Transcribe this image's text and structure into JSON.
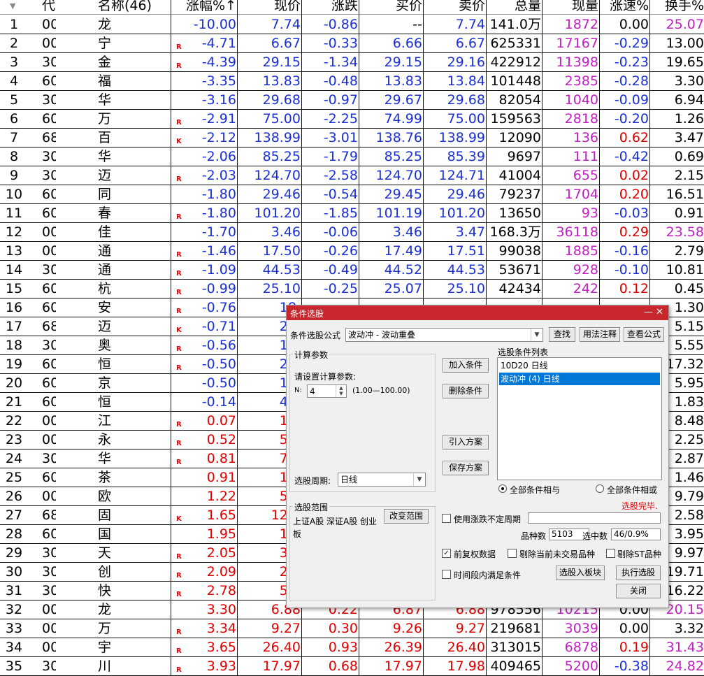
{
  "columns": [
    "代",
    "名称(46)",
    "涨幅%↑",
    "现价",
    "涨跌",
    "买价",
    "卖价",
    "总量",
    "现量",
    "涨速%",
    "换手%"
  ],
  "rows": [
    {
      "n": "1",
      "code": "00",
      "name": "龙",
      "r": "",
      "chg": "-10.00",
      "price": "7.74",
      "diff": "-0.86",
      "bid": "--",
      "ask": "7.74",
      "vol": "141.0万",
      "cur": "1872",
      "spd": "0.00",
      "turn": "25.07"
    },
    {
      "n": "2",
      "code": "00",
      "name": "宁",
      "r": "R",
      "chg": "-4.71",
      "price": "6.67",
      "diff": "-0.33",
      "bid": "6.66",
      "ask": "6.67",
      "vol": "625331",
      "cur": "17167",
      "spd": "-0.29",
      "turn": "13.00"
    },
    {
      "n": "3",
      "code": "30",
      "name": "金",
      "r": "R",
      "chg": "-4.39",
      "price": "29.15",
      "diff": "-1.34",
      "bid": "29.15",
      "ask": "29.16",
      "vol": "422912",
      "cur": "11398",
      "spd": "-0.23",
      "turn": "19.65"
    },
    {
      "n": "4",
      "code": "60",
      "name": "福",
      "r": "",
      "chg": "-3.35",
      "price": "13.83",
      "diff": "-0.48",
      "bid": "13.83",
      "ask": "13.84",
      "vol": "101448",
      "cur": "2385",
      "spd": "-0.28",
      "turn": "3.30"
    },
    {
      "n": "5",
      "code": "30",
      "name": "华",
      "r": "",
      "chg": "-3.16",
      "price": "29.68",
      "diff": "-0.97",
      "bid": "29.67",
      "ask": "29.68",
      "vol": "82054",
      "cur": "1040",
      "spd": "-0.09",
      "turn": "6.94"
    },
    {
      "n": "6",
      "code": "60",
      "name": "万",
      "r": "R",
      "chg": "-2.91",
      "price": "75.00",
      "diff": "-2.25",
      "bid": "74.99",
      "ask": "75.00",
      "vol": "159563",
      "cur": "2818",
      "spd": "-0.20",
      "turn": "1.26"
    },
    {
      "n": "7",
      "code": "68",
      "name": "百",
      "r": "K",
      "chg": "-2.12",
      "price": "138.99",
      "diff": "-3.01",
      "bid": "138.76",
      "ask": "138.99",
      "vol": "12090",
      "cur": "136",
      "spd": "0.62",
      "turn": "3.47"
    },
    {
      "n": "8",
      "code": "30",
      "name": "华",
      "r": "",
      "chg": "-2.06",
      "price": "85.25",
      "diff": "-1.79",
      "bid": "85.25",
      "ask": "85.39",
      "vol": "9697",
      "cur": "111",
      "spd": "-0.42",
      "turn": "0.69"
    },
    {
      "n": "9",
      "code": "30",
      "name": "迈",
      "r": "R",
      "chg": "-2.03",
      "price": "124.70",
      "diff": "-2.58",
      "bid": "124.70",
      "ask": "124.71",
      "vol": "41004",
      "cur": "655",
      "spd": "0.02",
      "turn": "2.15"
    },
    {
      "n": "10",
      "code": "60",
      "name": "同",
      "r": "",
      "chg": "-1.80",
      "price": "29.46",
      "diff": "-0.54",
      "bid": "29.45",
      "ask": "29.46",
      "vol": "79237",
      "cur": "1704",
      "spd": "0.20",
      "turn": "16.51"
    },
    {
      "n": "11",
      "code": "60",
      "name": "春",
      "r": "R",
      "chg": "-1.80",
      "price": "101.20",
      "diff": "-1.85",
      "bid": "101.19",
      "ask": "101.20",
      "vol": "13650",
      "cur": "93",
      "spd": "-0.03",
      "turn": "0.91"
    },
    {
      "n": "12",
      "code": "00",
      "name": "佳",
      "r": "",
      "chg": "-1.70",
      "price": "3.46",
      "diff": "-0.06",
      "bid": "3.46",
      "ask": "3.47",
      "vol": "168.3万",
      "cur": "36118",
      "spd": "0.29",
      "turn": "23.58"
    },
    {
      "n": "13",
      "code": "00",
      "name": "通",
      "r": "R",
      "chg": "-1.46",
      "price": "17.50",
      "diff": "-0.26",
      "bid": "17.49",
      "ask": "17.51",
      "vol": "99038",
      "cur": "1885",
      "spd": "-0.16",
      "turn": "2.79"
    },
    {
      "n": "14",
      "code": "30",
      "name": "通",
      "r": "R",
      "chg": "-1.09",
      "price": "44.53",
      "diff": "-0.49",
      "bid": "44.52",
      "ask": "44.53",
      "vol": "53671",
      "cur": "928",
      "spd": "-0.10",
      "turn": "10.81"
    },
    {
      "n": "15",
      "code": "60",
      "name": "杭",
      "r": "R",
      "chg": "-0.99",
      "price": "25.10",
      "diff": "-0.25",
      "bid": "25.07",
      "ask": "25.10",
      "vol": "42434",
      "cur": "242",
      "spd": "0.12",
      "turn": "0.45"
    },
    {
      "n": "16",
      "code": "60",
      "name": "安",
      "r": "R",
      "chg": "-0.76",
      "price": "18.",
      "diff": "",
      "bid": "",
      "ask": "",
      "vol": "",
      "cur": "",
      "spd": "",
      "turn": "1.30"
    },
    {
      "n": "17",
      "code": "68",
      "name": "迈",
      "r": "K",
      "chg": "-0.71",
      "price": "27.",
      "diff": "",
      "bid": "",
      "ask": "",
      "vol": "",
      "cur": "",
      "spd": "",
      "turn": "5.15"
    },
    {
      "n": "18",
      "code": "30",
      "name": "奥",
      "r": "R",
      "chg": "-0.56",
      "price": "10.",
      "diff": "",
      "bid": "",
      "ask": "",
      "vol": "",
      "cur": "",
      "spd": "",
      "turn": "5.55"
    },
    {
      "n": "19",
      "code": "60",
      "name": "恒",
      "r": "R",
      "chg": "-0.50",
      "price": "25.",
      "diff": "",
      "bid": "",
      "ask": "",
      "vol": "",
      "cur": "",
      "spd": "",
      "turn": "17.32"
    },
    {
      "n": "20",
      "code": "60",
      "name": "京",
      "r": "",
      "chg": "-0.50",
      "price": "17.",
      "diff": "",
      "bid": "",
      "ask": "",
      "vol": "",
      "cur": "",
      "spd": "",
      "turn": "5.95"
    },
    {
      "n": "21",
      "code": "60",
      "name": "恒",
      "r": "",
      "chg": "-0.14",
      "price": "43.",
      "diff": "",
      "bid": "",
      "ask": "",
      "vol": "",
      "cur": "",
      "spd": "",
      "turn": "1.83"
    },
    {
      "n": "22",
      "code": "00",
      "name": "江",
      "r": "R",
      "chg": "0.07",
      "price": "13.",
      "diff": "",
      "bid": "",
      "ask": "",
      "vol": "",
      "cur": "",
      "spd": "",
      "turn": "8.48"
    },
    {
      "n": "23",
      "code": "00",
      "name": "永",
      "r": "R",
      "chg": "0.52",
      "price": "51.",
      "diff": "",
      "bid": "",
      "ask": "",
      "vol": "",
      "cur": "",
      "spd": "",
      "turn": "2.25"
    },
    {
      "n": "24",
      "code": "30",
      "name": "华",
      "r": "R",
      "chg": "0.81",
      "price": "74.",
      "diff": "",
      "bid": "",
      "ask": "",
      "vol": "",
      "cur": "",
      "spd": "",
      "turn": "2.87"
    },
    {
      "n": "25",
      "code": "60",
      "name": "茶",
      "r": "",
      "chg": "0.91",
      "price": "17.",
      "diff": "",
      "bid": "",
      "ask": "",
      "vol": "",
      "cur": "",
      "spd": "",
      "turn": "1.46"
    },
    {
      "n": "26",
      "code": "00",
      "name": "欧",
      "r": "",
      "chg": "1.22",
      "price": "51.",
      "diff": "",
      "bid": "",
      "ask": "",
      "vol": "",
      "cur": "",
      "spd": "",
      "turn": "9.79"
    },
    {
      "n": "27",
      "code": "68",
      "name": "固",
      "r": "K",
      "chg": "1.65",
      "price": "128.",
      "diff": "",
      "bid": "",
      "ask": "",
      "vol": "",
      "cur": "",
      "spd": "",
      "turn": "2.58"
    },
    {
      "n": "28",
      "code": "60",
      "name": "国",
      "r": "",
      "chg": "1.95",
      "price": "10.",
      "diff": "",
      "bid": "",
      "ask": "",
      "vol": "",
      "cur": "",
      "spd": "",
      "turn": "3.95"
    },
    {
      "n": "29",
      "code": "30",
      "name": "天",
      "r": "R",
      "chg": "2.05",
      "price": "37.",
      "diff": "",
      "bid": "",
      "ask": "",
      "vol": "",
      "cur": "",
      "spd": "",
      "turn": "9.97"
    },
    {
      "n": "30",
      "code": "30",
      "name": "创",
      "r": "R",
      "chg": "2.09",
      "price": "25.",
      "diff": "",
      "bid": "",
      "ask": "",
      "vol": "",
      "cur": "",
      "spd": "",
      "turn": "19.71"
    },
    {
      "n": "31",
      "code": "30",
      "name": "快",
      "r": "R",
      "chg": "2.78",
      "price": "58.",
      "diff": "",
      "bid": "",
      "ask": "",
      "vol": "",
      "cur": "",
      "spd": "",
      "turn": "16.22"
    },
    {
      "n": "32",
      "code": "00",
      "name": "龙",
      "r": "",
      "chg": "3.30",
      "price": "6.88",
      "diff": "0.22",
      "bid": "6.87",
      "ask": "6.88",
      "vol": "978556",
      "cur": "10215",
      "spd": "0.00",
      "turn": "20.15"
    },
    {
      "n": "33",
      "code": "00",
      "name": "万",
      "r": "R",
      "chg": "3.34",
      "price": "9.27",
      "diff": "0.30",
      "bid": "9.26",
      "ask": "9.27",
      "vol": "219681",
      "cur": "3039",
      "spd": "0.00",
      "turn": "3.32"
    },
    {
      "n": "34",
      "code": "00",
      "name": "宇",
      "r": "R",
      "chg": "3.65",
      "price": "26.40",
      "diff": "0.93",
      "bid": "26.39",
      "ask": "26.40",
      "vol": "313015",
      "cur": "6878",
      "spd": "0.19",
      "turn": "31.43"
    },
    {
      "n": "35",
      "code": "30",
      "name": "川",
      "r": "R",
      "chg": "3.93",
      "price": "17.97",
      "diff": "0.68",
      "bid": "17.97",
      "ask": "17.98",
      "vol": "409465",
      "cur": "5200",
      "spd": "-0.38",
      "turn": "24.82"
    }
  ],
  "colors": {
    "up": "#e00000",
    "down": "#1a2fd6",
    "vol": "#c020c0",
    "text": "#000000"
  },
  "dialog": {
    "title": "条件选股",
    "minimize": "—",
    "close": "✕",
    "formula_label": "条件选股公式",
    "formula_value": "波动冲 - 波动重叠",
    "find_btn": "查找",
    "usage_btn": "用法注释",
    "view_btn": "查看公式",
    "calc_group": "计算参数",
    "param_prompt": "请设置计算参数:",
    "param_name": "N:",
    "param_value": "4",
    "param_range": "(1.00—100.00)",
    "period_label": "选股周期:",
    "period_value": "日线",
    "add_btn": "加入条件",
    "del_btn": "删除条件",
    "import_btn": "引入方案",
    "save_btn": "保存方案",
    "list_label": "选股条件列表",
    "list_items": [
      "10D20  日线",
      "波动冲 (4) 日线"
    ],
    "radio_and": "全部条件相与",
    "radio_or": "全部条件相或",
    "status": "选股完毕.",
    "scope_group": "选股范围",
    "scope_text": "上证A股 深证A股 创业板",
    "scope_btn": "改变范围",
    "chk_unfixed": "使用涨跌不定周期",
    "count_label": "品种数",
    "count_value": "5103",
    "selected_label": "选中数",
    "selected_value": "46/0.9%",
    "chk_adjust": "前复权数据",
    "chk_remove_notrade": "剔除当前未交易品种",
    "chk_remove_st": "剔除ST品种",
    "chk_period": "时间段内满足条件",
    "to_block_btn": "选股入板块",
    "run_btn": "执行选股",
    "close_btn": "关闭"
  }
}
